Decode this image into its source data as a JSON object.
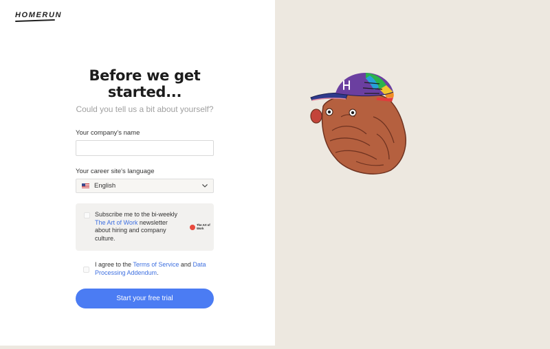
{
  "brand": {
    "logo_text": "HOMERUN"
  },
  "header": {
    "title": "Before we get started...",
    "subtitle": "Could you tell us a bit about yourself?"
  },
  "form": {
    "company": {
      "label": "Your company's name",
      "value": "",
      "placeholder": ""
    },
    "language": {
      "label": "Your career site's language",
      "value": "English",
      "flag": "us-flag-icon"
    },
    "newsletter": {
      "text_before": "Subscribe me to the bi-weekly ",
      "link": "The Art of Work",
      "text_after": " newsletter about hiring and company culture.",
      "logo_text": "The Art of Work",
      "checked": false
    },
    "terms": {
      "text_before": "I agree to the ",
      "terms_link": "Terms of Service",
      "middle": " and ",
      "data_link": "Data Processing Addendum",
      "end": ".",
      "checked": false
    },
    "submit_label": "Start your free trial"
  },
  "colors": {
    "accent": "#4b7cf3",
    "link": "#3d6fe0",
    "right_panel": "#ede8e0",
    "newsletter_bg": "#f2f1ef"
  },
  "illustration": {
    "icon": "dog-with-rainbow-cap-illustration"
  }
}
